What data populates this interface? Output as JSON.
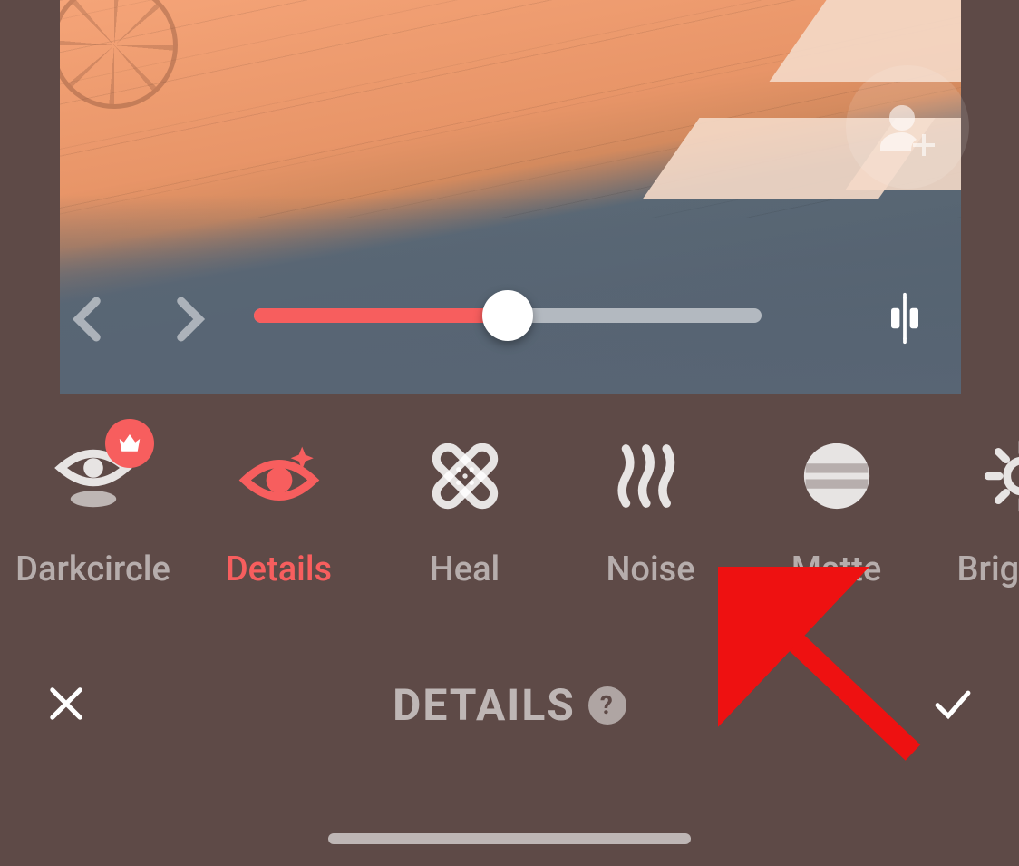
{
  "preview": {
    "slider_percent": 50,
    "overlay_icon": "user-add-icon"
  },
  "tools": [
    {
      "id": "darkcircle",
      "label": "Darkcircle",
      "icon": "eye-shadow-icon",
      "premium": true,
      "active": false
    },
    {
      "id": "details",
      "label": "Details",
      "icon": "eye-sparkle-icon",
      "premium": false,
      "active": true
    },
    {
      "id": "heal",
      "label": "Heal",
      "icon": "bandage-icon",
      "premium": false,
      "active": false
    },
    {
      "id": "noise",
      "label": "Noise",
      "icon": "noise-icon",
      "premium": false,
      "active": false
    },
    {
      "id": "matte",
      "label": "Matte",
      "icon": "matte-icon",
      "premium": false,
      "active": false
    },
    {
      "id": "brighten",
      "label": "Brighten",
      "icon": "sun-icon",
      "premium": false,
      "active": false
    }
  ],
  "bottom": {
    "title": "DETAILS",
    "help_glyph": "?"
  },
  "colors": {
    "accent": "#f75e5e"
  }
}
